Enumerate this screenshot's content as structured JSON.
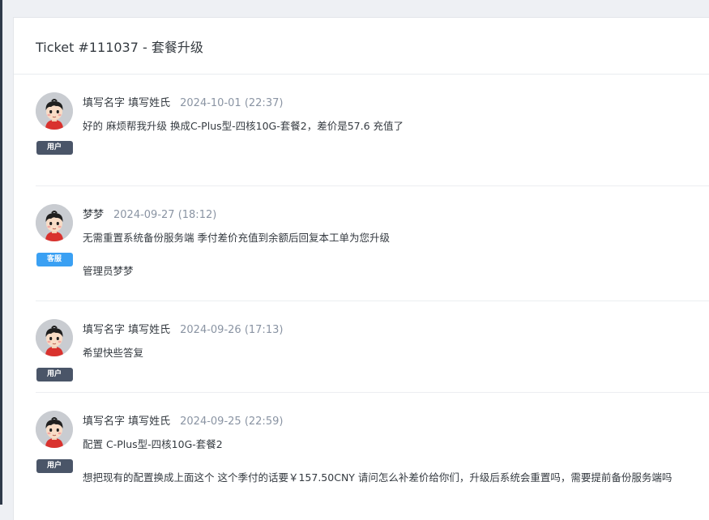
{
  "ticket": {
    "title": "Ticket #111037 - 套餐升级"
  },
  "messages": [
    {
      "author": "填写名字 填写姓氏",
      "date": "2024-10-01 (22:37)",
      "role": "用户",
      "lines": [
        "好的 麻烦帮我升级 换成C-Plus型-四核10G-套餐2，差价是57.6 充值了"
      ]
    },
    {
      "author": "梦梦",
      "date": "2024-09-27 (18:12)",
      "role": "客服",
      "lines": [
        "无需重置系统备份服务端 季付差价充值到余额后回复本工单为您升级",
        "管理员梦梦"
      ]
    },
    {
      "author": "填写名字 填写姓氏",
      "date": "2024-09-26 (17:13)",
      "role": "用户",
      "lines": [
        "希望快些答复"
      ]
    },
    {
      "author": "填写名字 填写姓氏",
      "date": "2024-09-25 (22:59)",
      "role": "用户",
      "lines": [
        "配置 C-Plus型-四核10G-套餐2",
        "想把现有的配置换成上面这个 这个季付的话要￥157.50CNY 请问怎么补差价给你们，升级后系统会重置吗，需要提前备份服务端吗"
      ]
    }
  ],
  "colors": {
    "user_badge": "#4a5568",
    "staff_badge": "#3aa0f3",
    "date_text": "#8a94a3"
  },
  "icons": {
    "avatar": "cartoon-person-avatar"
  }
}
